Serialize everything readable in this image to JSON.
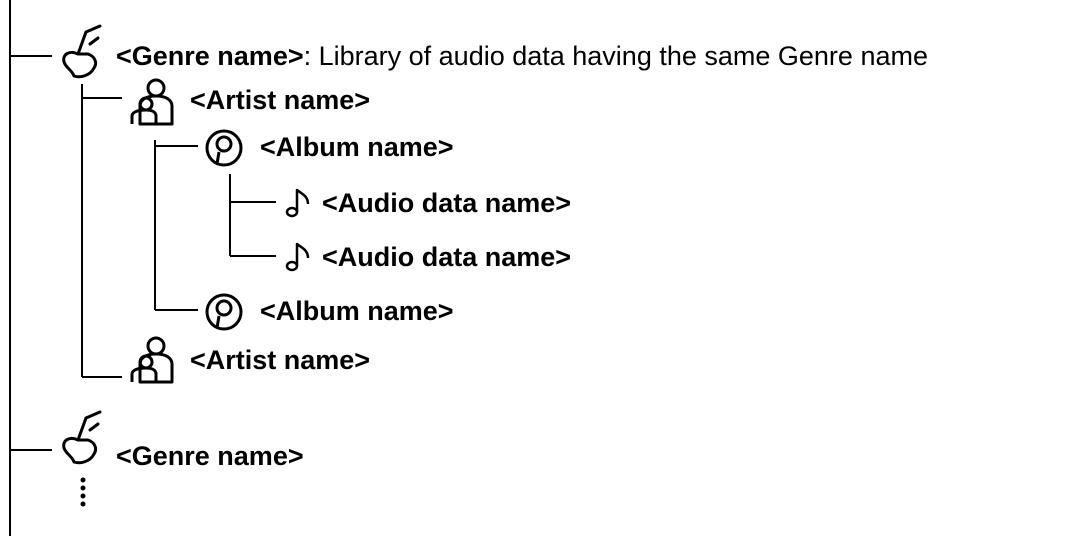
{
  "tree": {
    "genre_1": {
      "name": "<Genre name>",
      "description": ": Library of audio data having the same Genre name",
      "icon": "guitar-icon"
    },
    "artist_1": {
      "name": "<Artist name>",
      "icon": "artist-icon"
    },
    "album_1": {
      "name": "<Album name>",
      "icon": "album-disc-icon"
    },
    "audio_1": {
      "name": "<Audio data name>",
      "icon": "music-note-icon"
    },
    "audio_2": {
      "name": "<Audio data name>",
      "icon": "music-note-icon"
    },
    "album_2": {
      "name": "<Album name>",
      "icon": "album-disc-icon"
    },
    "artist_2": {
      "name": "<Artist name>",
      "icon": "artist-icon"
    },
    "genre_2": {
      "name": "<Genre name>",
      "icon": "guitar-icon"
    },
    "continuation": "⋮"
  }
}
